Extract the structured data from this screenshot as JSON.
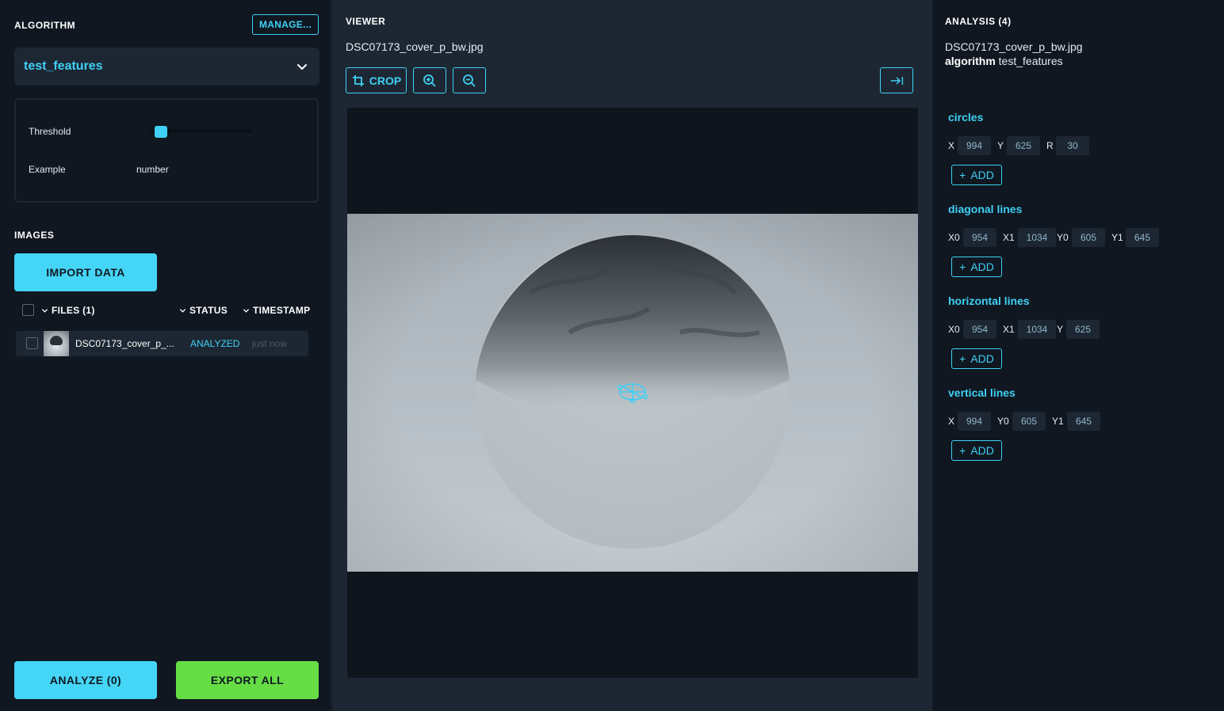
{
  "algorithm": {
    "title": "ALGORITHM",
    "manage_label": "MANAGE...",
    "selected": "test_features",
    "params": [
      {
        "label": "Threshold",
        "type": "slider",
        "value_fraction": 0.05
      },
      {
        "label": "Example",
        "value": "number"
      }
    ]
  },
  "images": {
    "title": "IMAGES",
    "import_label": "IMPORT DATA",
    "columns": {
      "files": "FILES (1)",
      "status": "STATUS",
      "timestamp": "TIMESTAMP"
    },
    "files": [
      {
        "name": "DSC07173_cover_p_...",
        "status": "ANALYZED",
        "time": "just now"
      }
    ]
  },
  "footer": {
    "analyze_label": "ANALYZE (0)",
    "export_label": "EXPORT ALL"
  },
  "viewer": {
    "title": "VIEWER",
    "filename": "DSC07173_cover_p_bw.jpg",
    "crop_label": "CROP"
  },
  "analysis": {
    "title": "ANALYSIS (4)",
    "filename": "DSC07173_cover_p_bw.jpg",
    "algorithm_key": "algorithm",
    "algorithm_value": "test_features",
    "add_label": "ADD",
    "groups": [
      {
        "name": "circles",
        "fields": [
          {
            "label": "X",
            "value": "994"
          },
          {
            "label": "Y",
            "value": "625"
          },
          {
            "label": "R",
            "value": "30"
          }
        ]
      },
      {
        "name": "diagonal lines",
        "fields": [
          {
            "label": "X0",
            "value": "954"
          },
          {
            "label": "X1",
            "value": "1034"
          },
          {
            "label": "Y0",
            "value": "605"
          },
          {
            "label": "Y1",
            "value": "645"
          }
        ]
      },
      {
        "name": "horizontal lines",
        "fields": [
          {
            "label": "X0",
            "value": "954"
          },
          {
            "label": "X1",
            "value": "1034"
          },
          {
            "label": "Y",
            "value": "625"
          }
        ]
      },
      {
        "name": "vertical lines",
        "fields": [
          {
            "label": "X",
            "value": "994"
          },
          {
            "label": "Y0",
            "value": "605"
          },
          {
            "label": "Y1",
            "value": "645"
          }
        ]
      }
    ]
  },
  "icons": [
    "chevron-down-icon",
    "crop-icon",
    "zoom-in-icon",
    "zoom-out-icon",
    "collapse-panel-icon",
    "plus-icon"
  ],
  "colors": {
    "accent": "#3fd0f5",
    "export": "#66dd45",
    "panel": "#101720",
    "surface": "#1d2733"
  }
}
